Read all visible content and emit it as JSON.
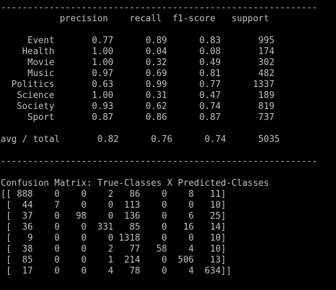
{
  "console": {
    "text_color": "#c0c0c0",
    "background_color": "#000000",
    "lines": [
      "-----------------------------------------------------------",
      "           precision    recall  f1-score   support",
      "",
      "     Event       0.77      0.89      0.83       995",
      "    Health       1.00      0.04      0.08       174",
      "     Movie       1.00      0.32      0.49       302",
      "     Music       0.97      0.69      0.81       482",
      "  Politics       0.63      0.99      0.77      1337",
      "   Science       1.00      0.31      0.47       189",
      "   Society       0.93      0.62      0.74       819",
      "     Sport       0.87      0.86      0.87       737",
      "",
      "avg / total       0.82      0.76      0.74      5035",
      "",
      "-----------------------------------------------------------",
      "",
      "Confusion Matrix: True-Classes X Predicted-Classes",
      "[[ 888    0    0    2   86    0    8   11]",
      " [  44    7    0    0  113    0    0   10]",
      " [  37    0   98    0  136    0    6   25]",
      " [  36    0    0  331   85    0   16   14]",
      " [   9    0    0    0 1318    0    0   10]",
      " [  38    0    0    2   77   58    4   10]",
      " [  85    0    0    1  214    0  506   13]",
      " [  17    0    0    4   78    0    4  634]]"
    ]
  }
}
